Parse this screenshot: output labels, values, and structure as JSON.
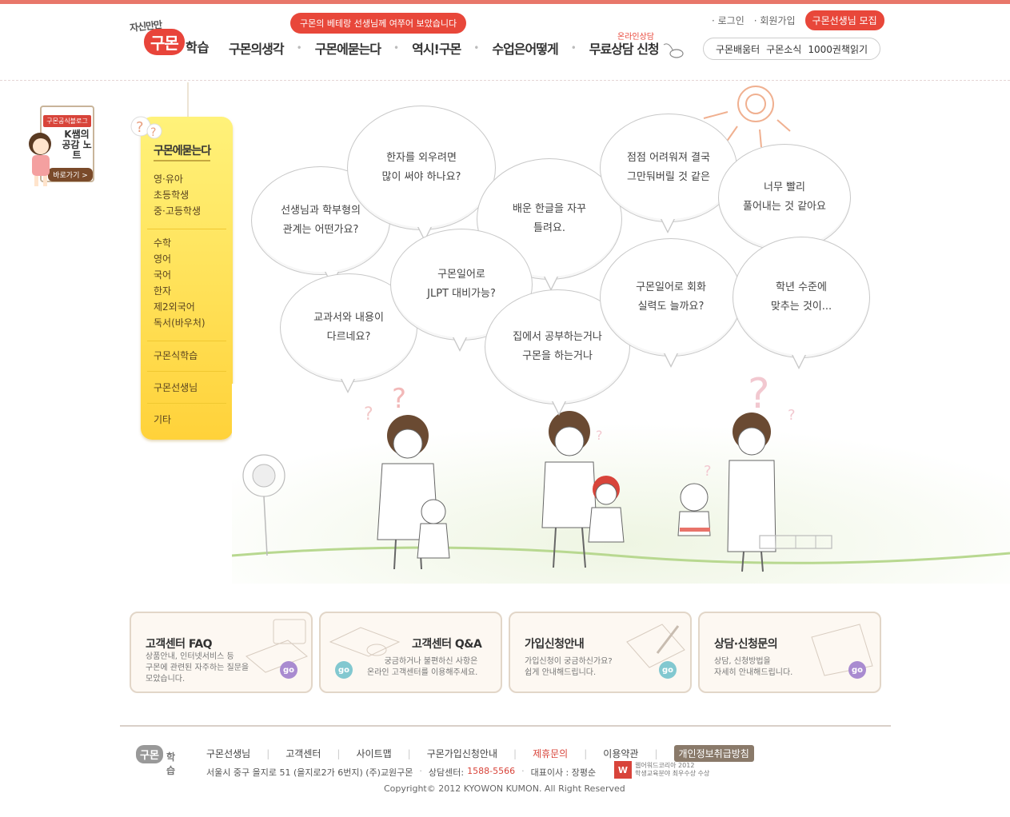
{
  "header": {
    "logo_tagline": "자신만만",
    "logo_main": "구몬",
    "logo_sub": "학습",
    "nav_banner": "구몬의 베테랑 선생님께 여쭈어 보았습니다",
    "nav": [
      "구몬의생각",
      "구몬에묻는다",
      "역시!구몬",
      "수업은어떻게",
      "무료상담 신청"
    ],
    "consult_tag": "온라인상담",
    "util": {
      "login": "· 로그인",
      "join": "· 회원가입",
      "recruit": "구몬선생님 모집"
    },
    "sub_links": [
      "구몬배움터",
      "구몬소식",
      "1000권책읽기"
    ]
  },
  "blog_badge": {
    "label": "구몬공식블로그",
    "title": "K쌤의 공감 노트",
    "go": "바로가기 >"
  },
  "side_menu": {
    "title": "구몬에묻는다",
    "group1": [
      "영·유아",
      "초등학생",
      "중·고등학생"
    ],
    "group2": [
      "수학",
      "영어",
      "국어",
      "한자",
      "제2외국어",
      "독서(바우처)"
    ],
    "items": [
      "구몬식학습",
      "구몬선생님",
      "기타"
    ]
  },
  "bubbles": [
    "선생님과 학부형의\n관계는 어떤가요?",
    "한자를 외우려면\n많이 써야 하나요?",
    "배운 한글을 자꾸\n틀려요.",
    "점점 어려워져 결국\n그만둬버릴 것 같은",
    "너무 빨리\n풀어내는 것 같아요",
    "교과서와 내용이\n다르네요?",
    "구몬일어로\nJLPT 대비가능?",
    "집에서 공부하는거나\n구몬을 하는거나",
    "구몬일어로 회화\n실력도 늘까요?",
    "학년 수준에\n맞추는 것이..."
  ],
  "boxes": [
    {
      "title": "고객센터 FAQ",
      "desc": "상품안내, 인터넷서비스 등\n구몬에 관련된 자주하는 질문을\n모았습니다.",
      "go": "go"
    },
    {
      "title": "고객센터 Q&A",
      "desc": "궁금하거나 불편하신 사항은\n온라인 고객센터를 이용해주세요.",
      "go": "go"
    },
    {
      "title": "가입신청안내",
      "desc": "가입신청이 궁금하신가요?\n쉽게 안내해드립니다.",
      "go": "go"
    },
    {
      "title": "상담·신청문의",
      "desc": "상담, 신청방법을\n자세히 안내해드립니다.",
      "go": "go"
    }
  ],
  "footer": {
    "logo_main": "구몬",
    "logo_sub": "학습",
    "nav": [
      "구몬선생님",
      "고객센터",
      "사이트맵",
      "구몬가입신청안내",
      "제휴문의",
      "이용약관",
      "개인정보취급방침"
    ],
    "address": "서울시 중구 을지로 51 (을지로2가 6번지) (주)교원구몬",
    "center_label": "상담센터:",
    "phone": "1588-5566",
    "ceo": "대표이사 : 장평순",
    "award_badge": "W",
    "award_text": "웹어워드코리아 2012\n학생교육분야 최우수상 수상",
    "copyright": "Copyright© 2012 KYOWON KUMON. All Right Reserved"
  },
  "colors": {
    "accent": "#e8473a",
    "menu_yellow": "#ffd23a",
    "box_border": "#e2d6c8",
    "go_purple": "#a98bd0",
    "go_teal": "#82c8d0"
  }
}
